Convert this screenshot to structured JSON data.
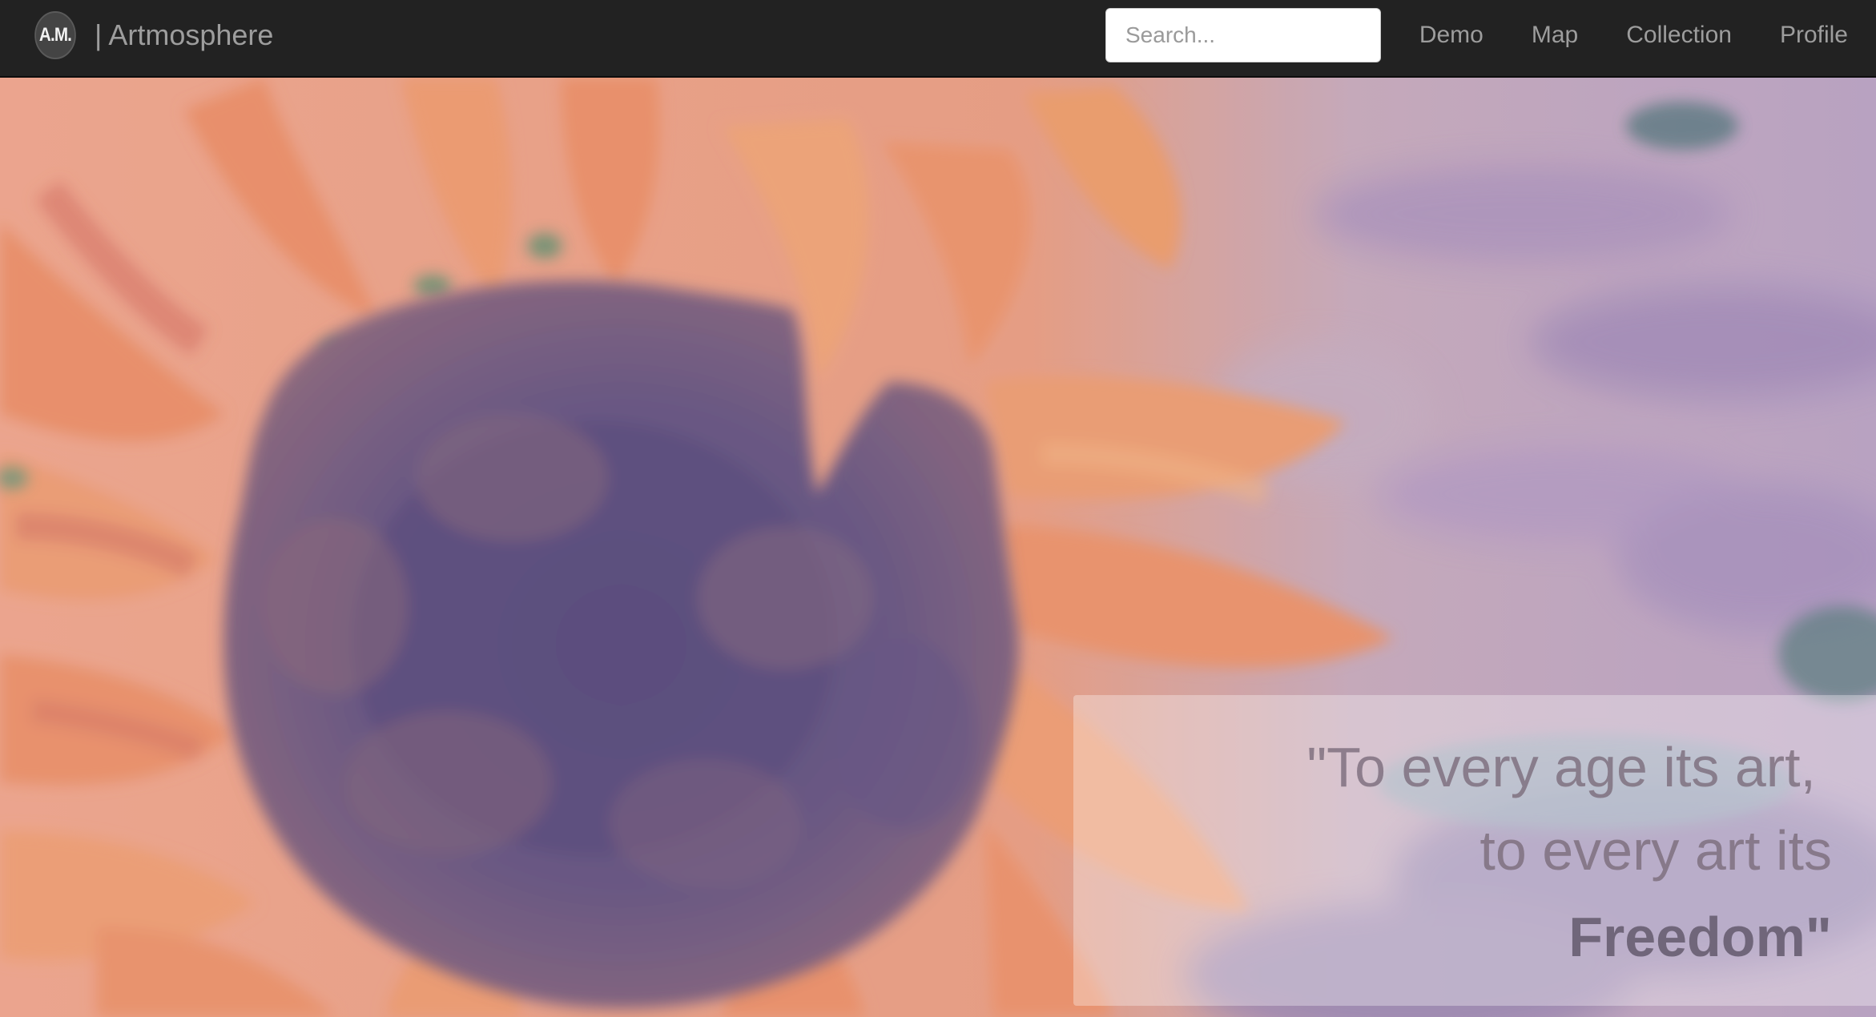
{
  "navbar": {
    "logo_text": "A.M.",
    "separator": "|",
    "brand_name": "Artmosphere",
    "search": {
      "placeholder": "Search...",
      "value": ""
    },
    "links": [
      "Demo",
      "Map",
      "Collection",
      "Profile"
    ]
  },
  "hero": {
    "image": "sunflower-painting",
    "quote": {
      "line1": "\"To every age its art,",
      "line2": "to every art its",
      "line3": "Freedom\""
    }
  },
  "colors": {
    "navbar_bg": "#222222",
    "nav_text": "#9d9d9d",
    "petal_orange": "#f0905f",
    "center_purple": "#5e4d78"
  }
}
